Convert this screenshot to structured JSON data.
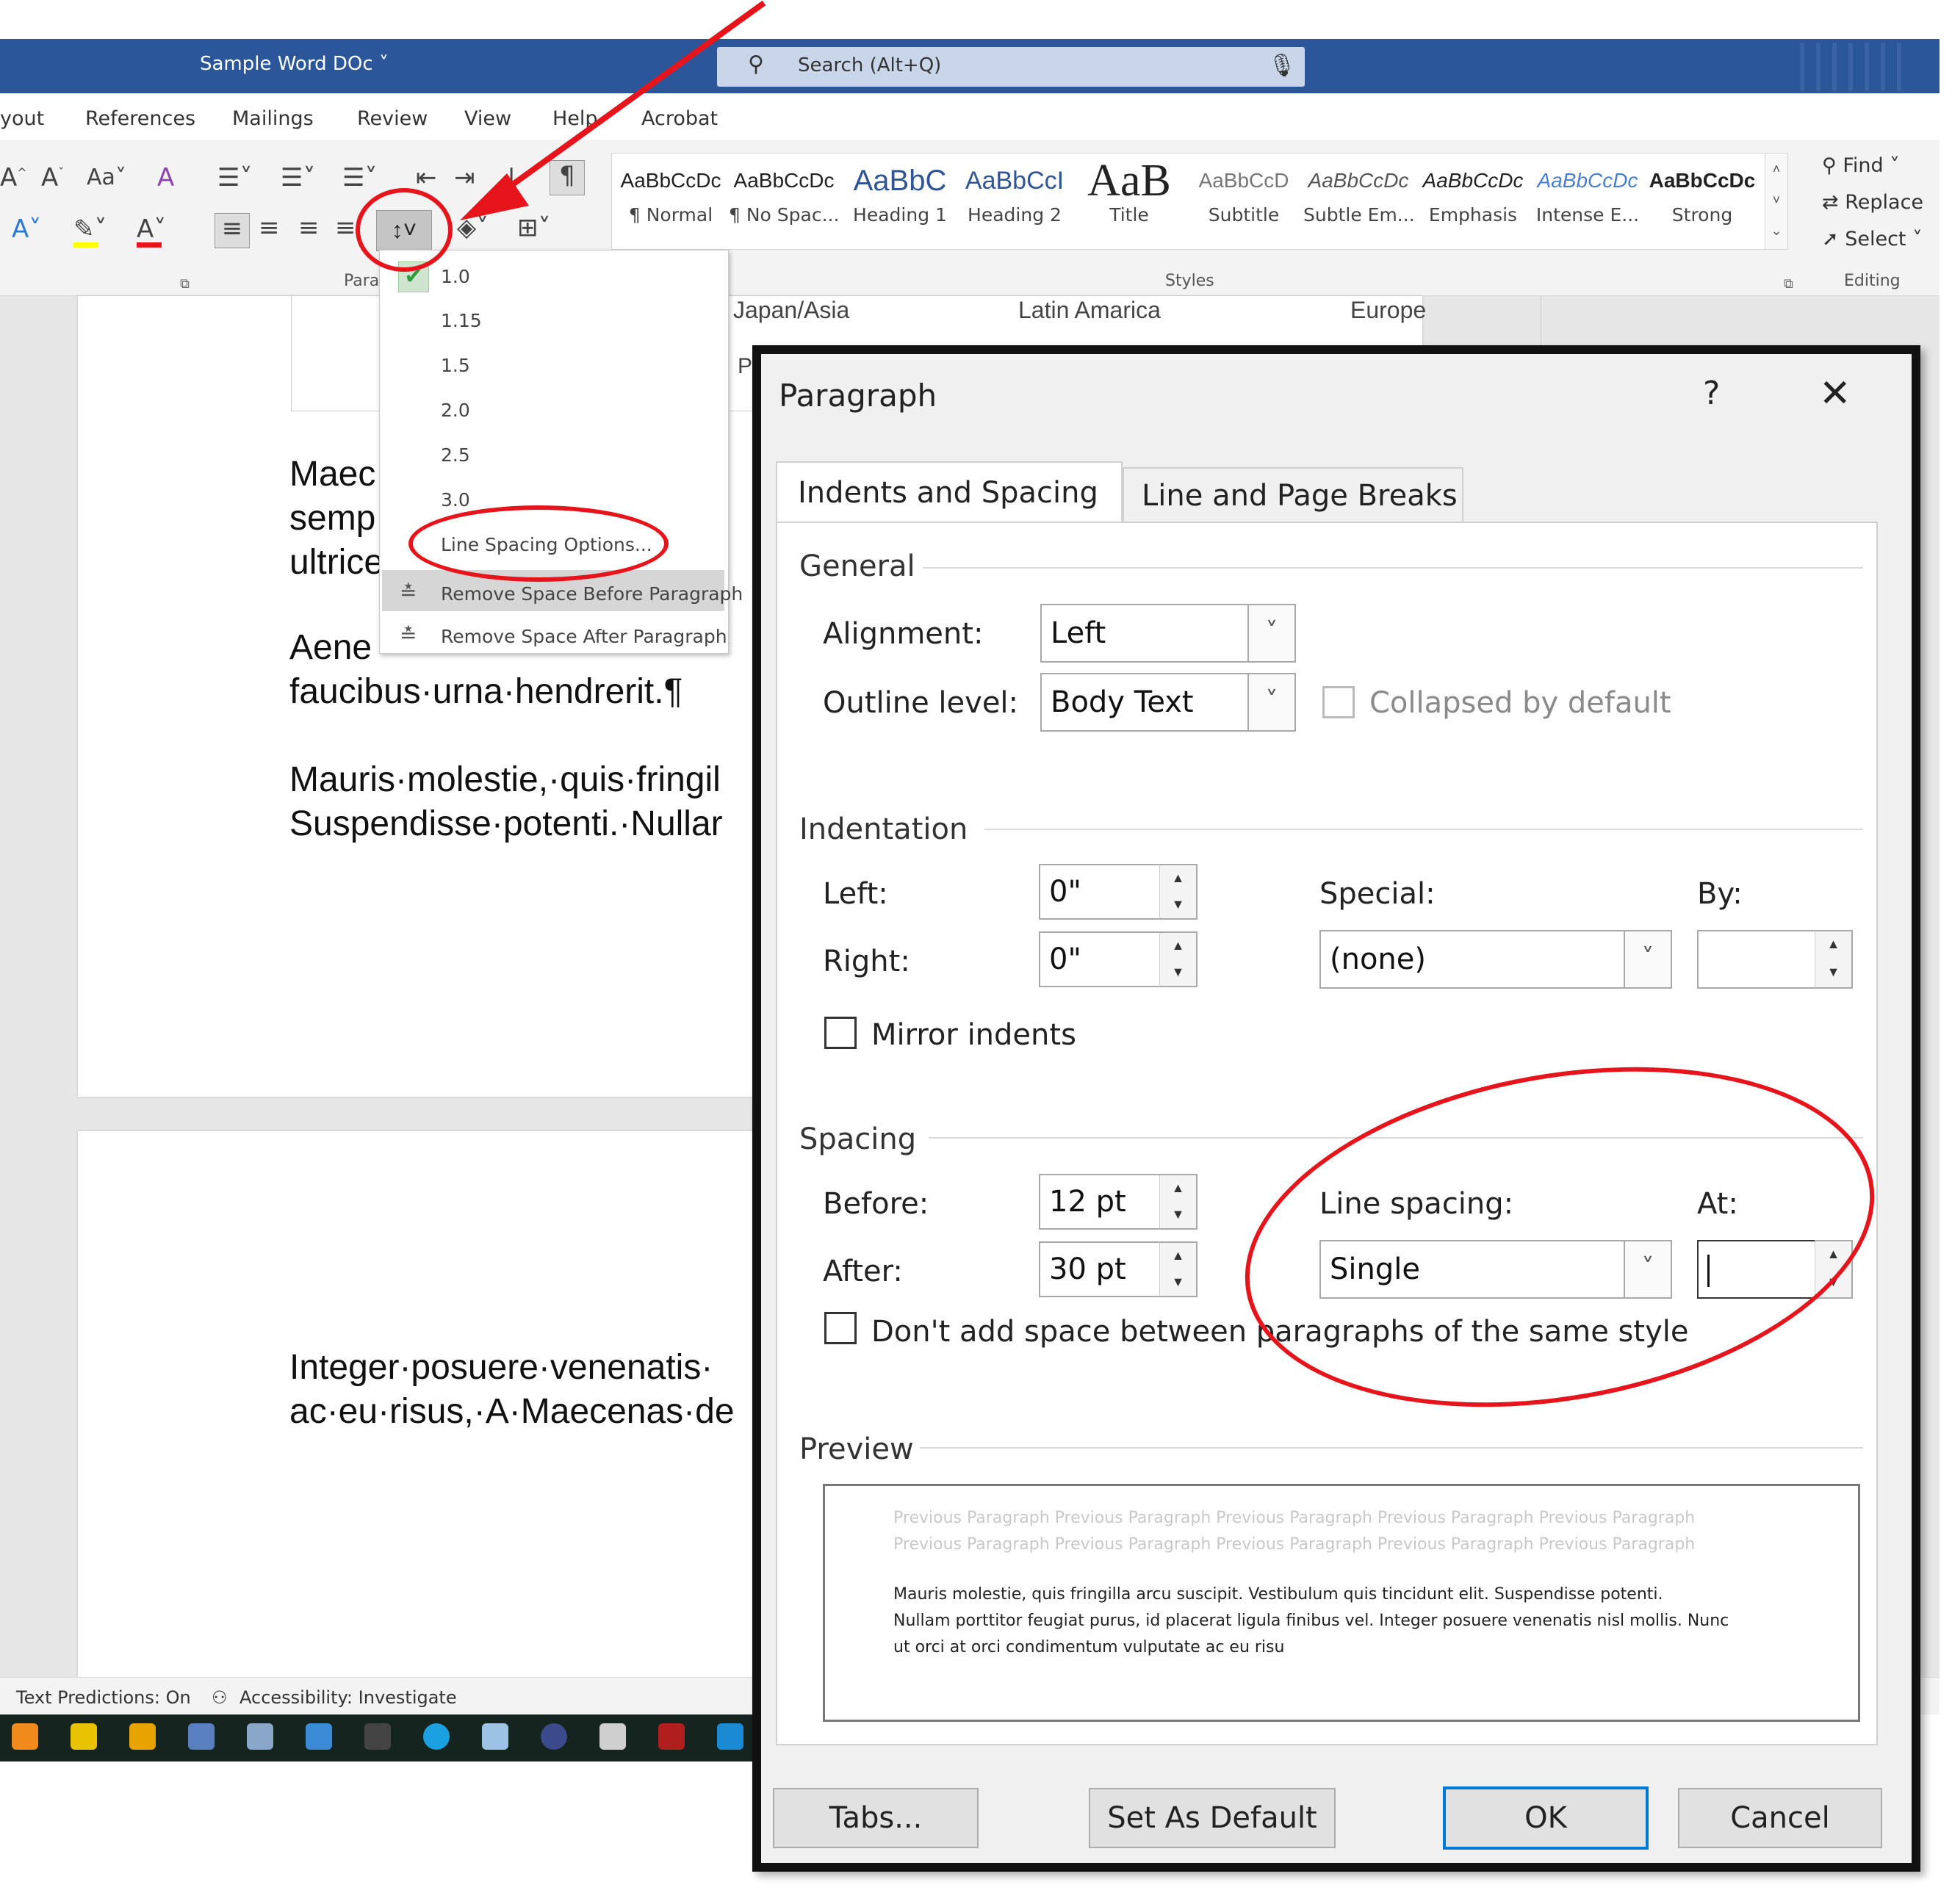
{
  "window": {
    "doc_title": "Sample Word DOc",
    "search_placeholder": "Search (Alt+Q)"
  },
  "menu_tabs": [
    "yout",
    "References",
    "Mailings",
    "Review",
    "View",
    "Help",
    "Acrobat"
  ],
  "ribbon": {
    "paragraph_group_label": "Para",
    "styles_group_label": "Styles",
    "editing_group_label": "Editing",
    "styles": [
      {
        "sample": "AaBbCcDc",
        "name": "¶ Normal"
      },
      {
        "sample": "AaBbCcDc",
        "name": "¶ No Spac..."
      },
      {
        "sample": "AaBbC",
        "name": "Heading 1"
      },
      {
        "sample": "AaBbCcI",
        "name": "Heading 2"
      },
      {
        "sample": "AaB",
        "name": "Title"
      },
      {
        "sample": "AaBbCcD",
        "name": "Subtitle"
      },
      {
        "sample": "AaBbCcDc",
        "name": "Subtle Em..."
      },
      {
        "sample": "AaBbCcDc",
        "name": "Emphasis"
      },
      {
        "sample": "AaBbCcDc",
        "name": "Intense E..."
      },
      {
        "sample": "AaBbCcDc",
        "name": "Strong"
      }
    ],
    "editing": {
      "find": "Find",
      "replace": "Replace",
      "select": "Select"
    }
  },
  "line_spacing_menu": {
    "options": [
      "1.0",
      "1.15",
      "1.5",
      "2.0",
      "2.5",
      "3.0"
    ],
    "checked": "1.0",
    "line_spacing_options": "Line Spacing Options...",
    "remove_before": "Remove Space Before Paragraph",
    "remove_after": "Remove Space After Paragraph"
  },
  "document": {
    "column_headers": [
      "Japan/Asia",
      "Latin Amarica",
      "Europe"
    ],
    "fragment_p": "P",
    "lines": [
      "Maec",
      "semp",
      "ultrice",
      "Aene",
      "faucibus·urna·hendrerit.¶",
      "Mauris·molestie,·quis·fringil",
      "Suspendisse·potenti.·Nullar",
      "Integer·posuere·venenatis·",
      "ac·eu·risus,·A·Maecenas·de"
    ]
  },
  "status": {
    "text_predictions": "Text Predictions: On",
    "accessibility": "Accessibility: Investigate"
  },
  "dialog": {
    "title": "Paragraph",
    "help": "?",
    "tabs": [
      "Indents and Spacing",
      "Line and Page Breaks"
    ],
    "general": {
      "label": "General",
      "alignment_label": "Alignment:",
      "alignment_value": "Left",
      "outline_label": "Outline level:",
      "outline_value": "Body Text",
      "collapsed_label": "Collapsed by default"
    },
    "indentation": {
      "label": "Indentation",
      "left_label": "Left:",
      "left_value": "0\"",
      "right_label": "Right:",
      "right_value": "0\"",
      "special_label": "Special:",
      "special_value": "(none)",
      "by_label": "By:",
      "by_value": "",
      "mirror_label": "Mirror indents"
    },
    "spacing": {
      "label": "Spacing",
      "before_label": "Before:",
      "before_value": "12 pt",
      "after_label": "After:",
      "after_value": "30 pt",
      "line_spacing_label": "Line spacing:",
      "line_spacing_value": "Single",
      "at_label": "At:",
      "at_value": "",
      "dont_add_label": "Don't add space between paragraphs of the same style"
    },
    "preview": {
      "label": "Preview",
      "previous_line": "Previous Paragraph Previous Paragraph Previous Paragraph Previous Paragraph Previous Paragraph",
      "current_lines": [
        "Mauris molestie, quis fringilla arcu suscipit. Vestibulum quis tincidunt elit. Suspendisse potenti.",
        "Nullam porttitor feugiat purus, id placerat ligula finibus vel. Integer posuere venenatis nisl mollis. Nunc",
        "ut orci at orci condimentum vulputate ac eu risu"
      ]
    },
    "buttons": {
      "tabs": "Tabs...",
      "set_default": "Set As Default",
      "ok": "OK",
      "cancel": "Cancel"
    }
  },
  "colors": {
    "titlebar": "#2b579a",
    "annotation": "#e8141b",
    "ok_border": "#0078d7"
  }
}
